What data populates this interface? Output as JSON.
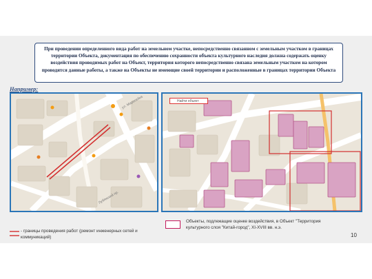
{
  "slide": {
    "callout_text": "При проведении определенного вида работ на земельном участке, непосредственно связанном с земельным участком в границах территории Объекта, документация по обеспечению сохранности объекта культурного наследия должна содержать оценку воздействия проводимых работ на Объект, территория которого непосредственно связана земельным участком на котором проводятся данные работы, а также на Объекты не имеющие своей территории и расположенные в границах территории Объекта",
    "example_label": "Например:",
    "left_map": {
      "streets": [
        "ул. Маросейка",
        "Лубянский пр."
      ]
    },
    "right_map": {
      "search_placeholder": "Найти объект"
    },
    "legend_left": "- границы проведения работ (ремонт инженерных сетей и коммуникаций)",
    "legend_right": "Объекты, подлежащие оценке воздействия, в Объект \"Территория культурного слоя \"Китай-город\", XI-XVIII вв. н.э.",
    "page_number": "10"
  },
  "colors": {
    "frame_blue": "#2a75b8",
    "work_line_red": "#d32f2f",
    "object_pink": "#c2185b",
    "object_fill": "#d9a3c3",
    "callout_border": "#2e4a7c"
  }
}
